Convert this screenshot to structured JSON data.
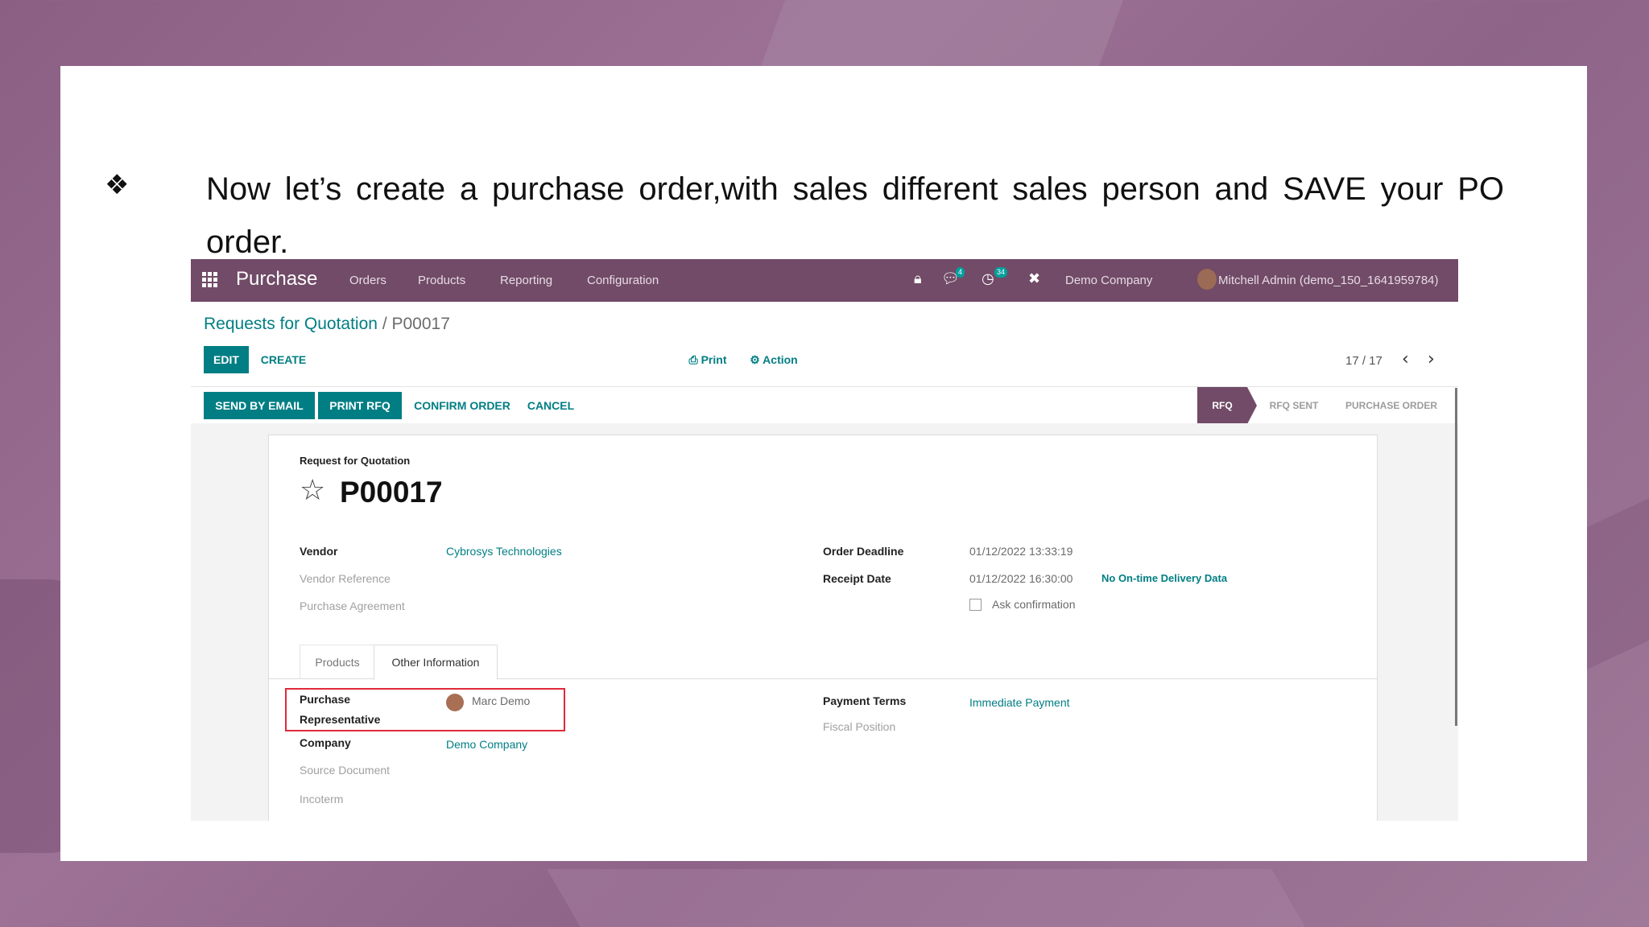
{
  "slide": {
    "bullet_glyph": "❖",
    "text": "Now let’s create a purchase order,with sales different sales person and SAVE your PO order."
  },
  "app": {
    "name": "Purchase",
    "menu": [
      "Orders",
      "Products",
      "Reporting",
      "Configuration"
    ],
    "messages_badge": "4",
    "activities_badge": "34",
    "company": "Demo Company",
    "user": "Mitchell Admin (demo_150_1641959784)"
  },
  "breadcrumb": {
    "parent": "Requests for Quotation",
    "separator": "/",
    "current": "P00017"
  },
  "control_panel": {
    "edit": "EDIT",
    "create": "CREATE",
    "print": "⎙ Print",
    "action": "⚙ Action",
    "pager": "17 / 17",
    "prev": "‹",
    "next": "›"
  },
  "status_actions": {
    "send_email": "SEND BY EMAIL",
    "print_rfq": "PRINT RFQ",
    "confirm": "CONFIRM ORDER",
    "cancel": "CANCEL"
  },
  "stages": [
    {
      "label": "RFQ",
      "active": true
    },
    {
      "label": "RFQ SENT",
      "active": false
    },
    {
      "label": "PURCHASE ORDER",
      "active": false
    }
  ],
  "form": {
    "subtitle": "Request for Quotation",
    "name": "P00017",
    "left_fields": {
      "vendor_label": "Vendor",
      "vendor_value": "Cybrosys Technologies",
      "vendor_ref_label": "Vendor Reference",
      "agreement_label": "Purchase Agreement"
    },
    "right_fields": {
      "deadline_label": "Order Deadline",
      "deadline_value": "01/12/2022 13:33:19",
      "receipt_label": "Receipt Date",
      "receipt_value": "01/12/2022 16:30:00",
      "ontime_link": "No On-time Delivery Data",
      "ask_confirmation": "Ask confirmation"
    },
    "tabs": [
      "Products",
      "Other Information"
    ],
    "active_tab": "Other Information",
    "other_info": {
      "rep_label_line1": "Purchase",
      "rep_label_line2": "Representative",
      "rep_value": "Marc Demo",
      "company_label": "Company",
      "company_value": "Demo Company",
      "source_label": "Source Document",
      "incoterm_label": "Incoterm",
      "payment_terms_label": "Payment Terms",
      "payment_terms_value": "Immediate Payment",
      "fiscal_label": "Fiscal Position"
    }
  },
  "colors": {
    "brand": "#714b67",
    "accent": "#017e84",
    "highlight": "#e0293b"
  }
}
